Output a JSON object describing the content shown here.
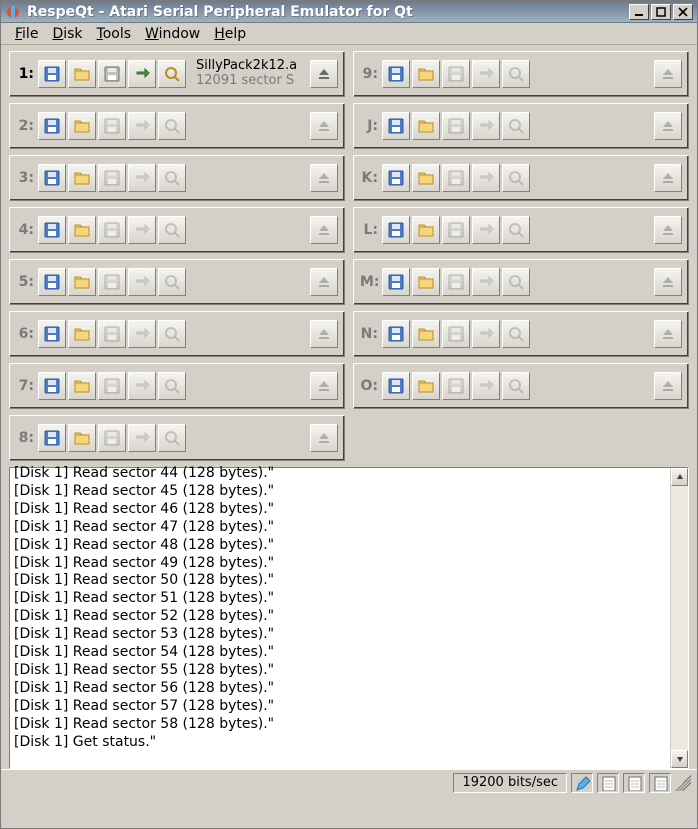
{
  "window": {
    "title": "RespeQt - Atari Serial Peripheral Emulator for Qt",
    "buttons": {
      "min_tip": "Minimize",
      "max_tip": "Maximize",
      "close_tip": "Close"
    }
  },
  "menu": {
    "items": [
      {
        "label": "File",
        "accel": "F"
      },
      {
        "label": "Disk",
        "accel": "D"
      },
      {
        "label": "Tools",
        "accel": "T"
      },
      {
        "label": "Window",
        "accel": "W"
      },
      {
        "label": "Help",
        "accel": "H"
      }
    ]
  },
  "icons": {
    "disk": "disk-icon",
    "folder": "folder-icon",
    "save": "save-disk-icon",
    "swap": "swap-icon",
    "explore": "explore-icon",
    "eject": "eject-icon"
  },
  "slots": {
    "left": [
      {
        "id": "1",
        "mounted": true,
        "image_name": "SillyPack2k12.a",
        "image_detail": "12091 sector S"
      },
      {
        "id": "2",
        "mounted": false
      },
      {
        "id": "3",
        "mounted": false
      },
      {
        "id": "4",
        "mounted": false
      },
      {
        "id": "5",
        "mounted": false
      },
      {
        "id": "6",
        "mounted": false
      },
      {
        "id": "7",
        "mounted": false
      },
      {
        "id": "8",
        "mounted": false
      }
    ],
    "right": [
      {
        "id": "9",
        "mounted": false
      },
      {
        "id": "J",
        "mounted": false
      },
      {
        "id": "K",
        "mounted": false
      },
      {
        "id": "L",
        "mounted": false
      },
      {
        "id": "M",
        "mounted": false
      },
      {
        "id": "N",
        "mounted": false
      },
      {
        "id": "O",
        "mounted": false
      }
    ]
  },
  "log_lines": [
    "[Disk 1] Read sector 44 (128 bytes).\"",
    "[Disk 1] Read sector 45 (128 bytes).\"",
    "[Disk 1] Read sector 46 (128 bytes).\"",
    "[Disk 1] Read sector 47 (128 bytes).\"",
    "[Disk 1] Read sector 48 (128 bytes).\"",
    "[Disk 1] Read sector 49 (128 bytes).\"",
    "[Disk 1] Read sector 50 (128 bytes).\"",
    "[Disk 1] Read sector 51 (128 bytes).\"",
    "[Disk 1] Read sector 52 (128 bytes).\"",
    "[Disk 1] Read sector 53 (128 bytes).\"",
    "[Disk 1] Read sector 54 (128 bytes).\"",
    "[Disk 1] Read sector 55 (128 bytes).\"",
    "[Disk 1] Read sector 56 (128 bytes).\"",
    "[Disk 1] Read sector 57 (128 bytes).\"",
    "[Disk 1] Read sector 58 (128 bytes).\"",
    "[Disk 1] Get status.\""
  ],
  "status": {
    "speed": "19200 bits/sec",
    "icons": [
      "clear-log-icon",
      "print-icon",
      "capture-icon",
      "settings-icon"
    ]
  }
}
